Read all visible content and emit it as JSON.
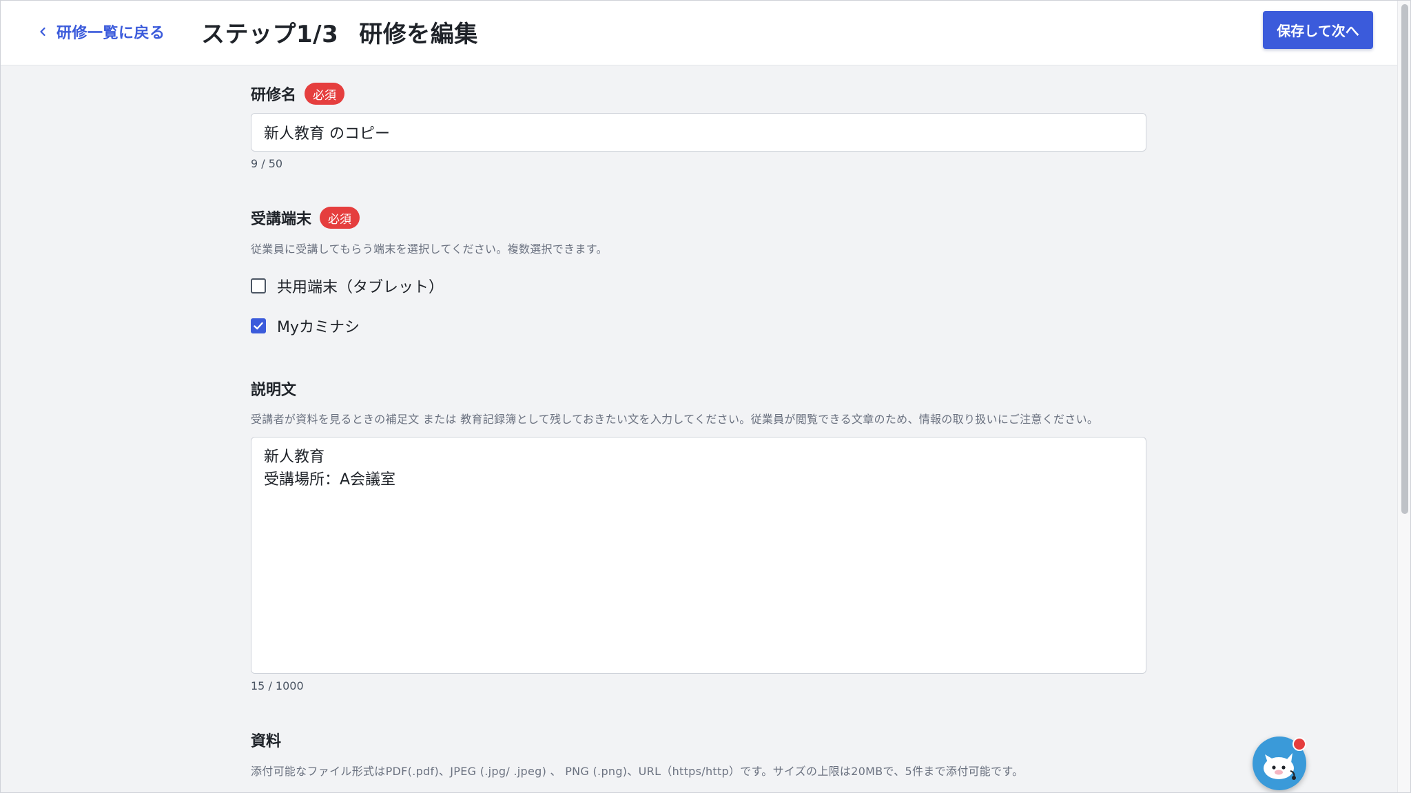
{
  "header": {
    "back_label": "研修一覧に戻る",
    "title_step": "ステップ1/3",
    "title_main": "研修を編集",
    "save_next_label": "保存して次へ"
  },
  "training_name": {
    "label": "研修名",
    "required_badge": "必須",
    "value": "新人教育 のコピー",
    "counter": "9 / 50"
  },
  "device": {
    "label": "受講端末",
    "required_badge": "必須",
    "help": "従業員に受講してもらう端末を選択してください。複数選択できます。",
    "options": [
      {
        "label": "共用端末（タブレット）",
        "checked": false
      },
      {
        "label": "Myカミナシ",
        "checked": true
      }
    ]
  },
  "description": {
    "label": "説明文",
    "help": "受講者が資料を見るときの補足文 または 教育記録簿として残しておきたい文を入力してください。従業員が閲覧できる文章のため、情報の取り扱いにご注意ください。",
    "lines": [
      "新人教育",
      "受講場所：A会議室"
    ],
    "counter": "15 / 1000"
  },
  "materials": {
    "label": "資料",
    "help": "添付可能なファイル形式はPDF(.pdf)、JPEG (.jpg/ .jpeg) 、 PNG (.png)、URL（https/http）です。サイズの上限は20MBで、5件まで添付可能です。"
  },
  "colors": {
    "primary": "#3b5bdb",
    "required": "#e53e3e",
    "background": "#f2f3f5",
    "chatbot": "#3a9ad9"
  },
  "icons": {
    "back": "chevron-left-icon",
    "checkbox_checked": "check-icon",
    "chatbot": "chatbot-mascot-icon"
  }
}
